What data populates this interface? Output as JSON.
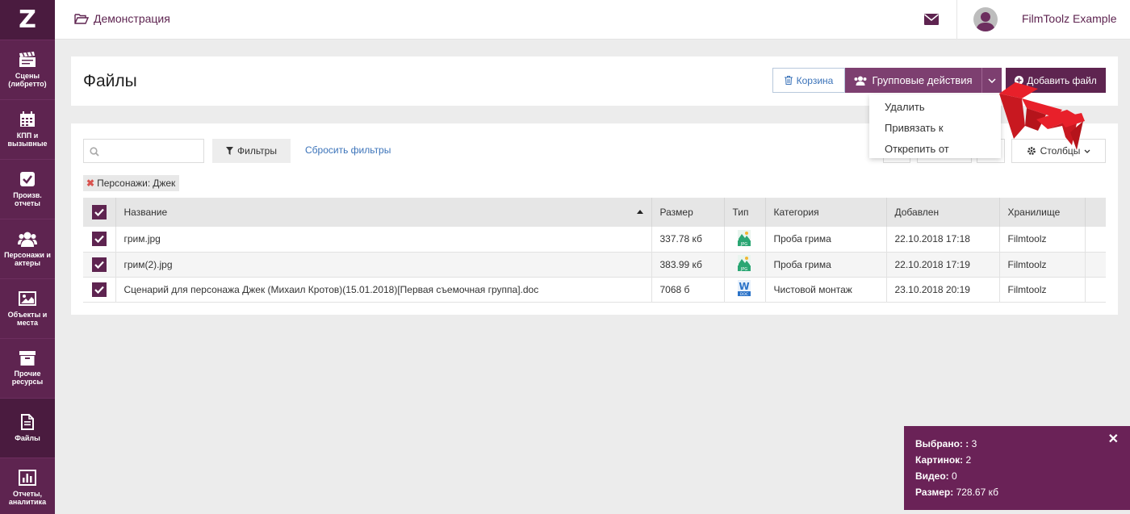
{
  "sidebar": {
    "logo": "Z",
    "items": [
      {
        "label": "Сцены (либретто)",
        "icon": "clapperboard-icon"
      },
      {
        "label": "КПП и вызывные",
        "icon": "calendar-icon"
      },
      {
        "label": "Произв. отчеты",
        "icon": "checkbox-icon"
      },
      {
        "label": "Персонажи и актеры",
        "icon": "users-icon"
      },
      {
        "label": "Объекты и места",
        "icon": "image-icon"
      },
      {
        "label": "Прочие ресурсы",
        "icon": "archive-box-icon"
      },
      {
        "label": "Файлы",
        "icon": "file-icon"
      },
      {
        "label": "Отчеты, аналитика",
        "icon": "bar-chart-icon"
      }
    ]
  },
  "header": {
    "breadcrumb": "Демонстрация",
    "user_name": "FilmToolz Example"
  },
  "page": {
    "title": "Файлы",
    "trash_label": "Корзина",
    "group_actions_label": "Групповые действия",
    "add_file_label": "Добавить файл"
  },
  "dropdown": {
    "items": [
      "Удалить",
      "Привязать к",
      "Открепить от"
    ]
  },
  "filters": {
    "search_value": "",
    "filter_label": "Фильтры",
    "reset_label": "Сбросить фильтры",
    "columns_label": "Столбцы",
    "active_tag_key": "Персонажи:",
    "active_tag_value": "Джек"
  },
  "table": {
    "columns": [
      "Название",
      "Размер",
      "Тип",
      "Категория",
      "Добавлен",
      "Хранилище"
    ],
    "sort_column": "Название",
    "rows": [
      {
        "checked": true,
        "name": "грим.jpg",
        "size": "337.78 кб",
        "type": "jpg",
        "category": "Проба грима",
        "added": "22.10.2018 17:18",
        "storage": "Filmtoolz"
      },
      {
        "checked": true,
        "name": "грим(2).jpg",
        "size": "383.99 кб",
        "type": "jpg",
        "category": "Проба грима",
        "added": "22.10.2018 17:19",
        "storage": "Filmtoolz"
      },
      {
        "checked": true,
        "name": "Сценарий для персонажа Джек (Михаил Кротов)(15.01.2018)[Первая съемочная группа].doc",
        "size": "7068 б",
        "type": "doc",
        "category": "Чистовой монтаж",
        "added": "23.10.2018 20:19",
        "storage": "Filmtoolz"
      }
    ]
  },
  "selection_panel": {
    "selected_label": "Выбрано: :",
    "selected_value": "3",
    "images_label": "Картинок:",
    "images_value": "2",
    "video_label": "Видео:",
    "video_value": "0",
    "size_label": "Размер:",
    "size_value": "728.67 кб"
  },
  "colors": {
    "brand": "#5e2450",
    "button": "#7d3f70",
    "link": "#3b73b9",
    "panel": "#6a2257",
    "arrow": "#e8202a"
  }
}
